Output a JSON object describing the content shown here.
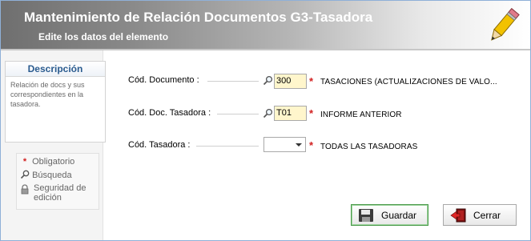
{
  "header": {
    "title": "Mantenimiento de Relación Documentos G3-Tasadora",
    "subtitle": "Edite los datos del elemento"
  },
  "description_panel": {
    "title": "Descripción",
    "text": "Relación de docs y sus correspondientes en la tasadora."
  },
  "legend": {
    "required": "Obligatorio",
    "search": "Búsqueda",
    "security": "Seguridad de edición"
  },
  "fields": {
    "doc_code": {
      "label": "Cód. Documento :",
      "value": "300",
      "description": "TASACIONES (ACTUALIZACIONES DE VALO..."
    },
    "appraiser_doc_code": {
      "label": "Cód. Doc. Tasadora :",
      "value": "T01",
      "description": "INFORME ANTERIOR"
    },
    "appraiser_code": {
      "label": "Cód. Tasadora :",
      "value": "",
      "description": "TODAS LAS TASADORAS"
    }
  },
  "buttons": {
    "save": "Guardar",
    "close": "Cerrar"
  },
  "colors": {
    "required_star": "#d22020",
    "input_background": "#fff6cc",
    "description_title": "#2a5b8f",
    "save_border": "#4a9a4a"
  },
  "icons": [
    "pencil-icon",
    "search-icon",
    "lock-icon",
    "save-icon",
    "exit-icon",
    "chevron-down-icon"
  ]
}
